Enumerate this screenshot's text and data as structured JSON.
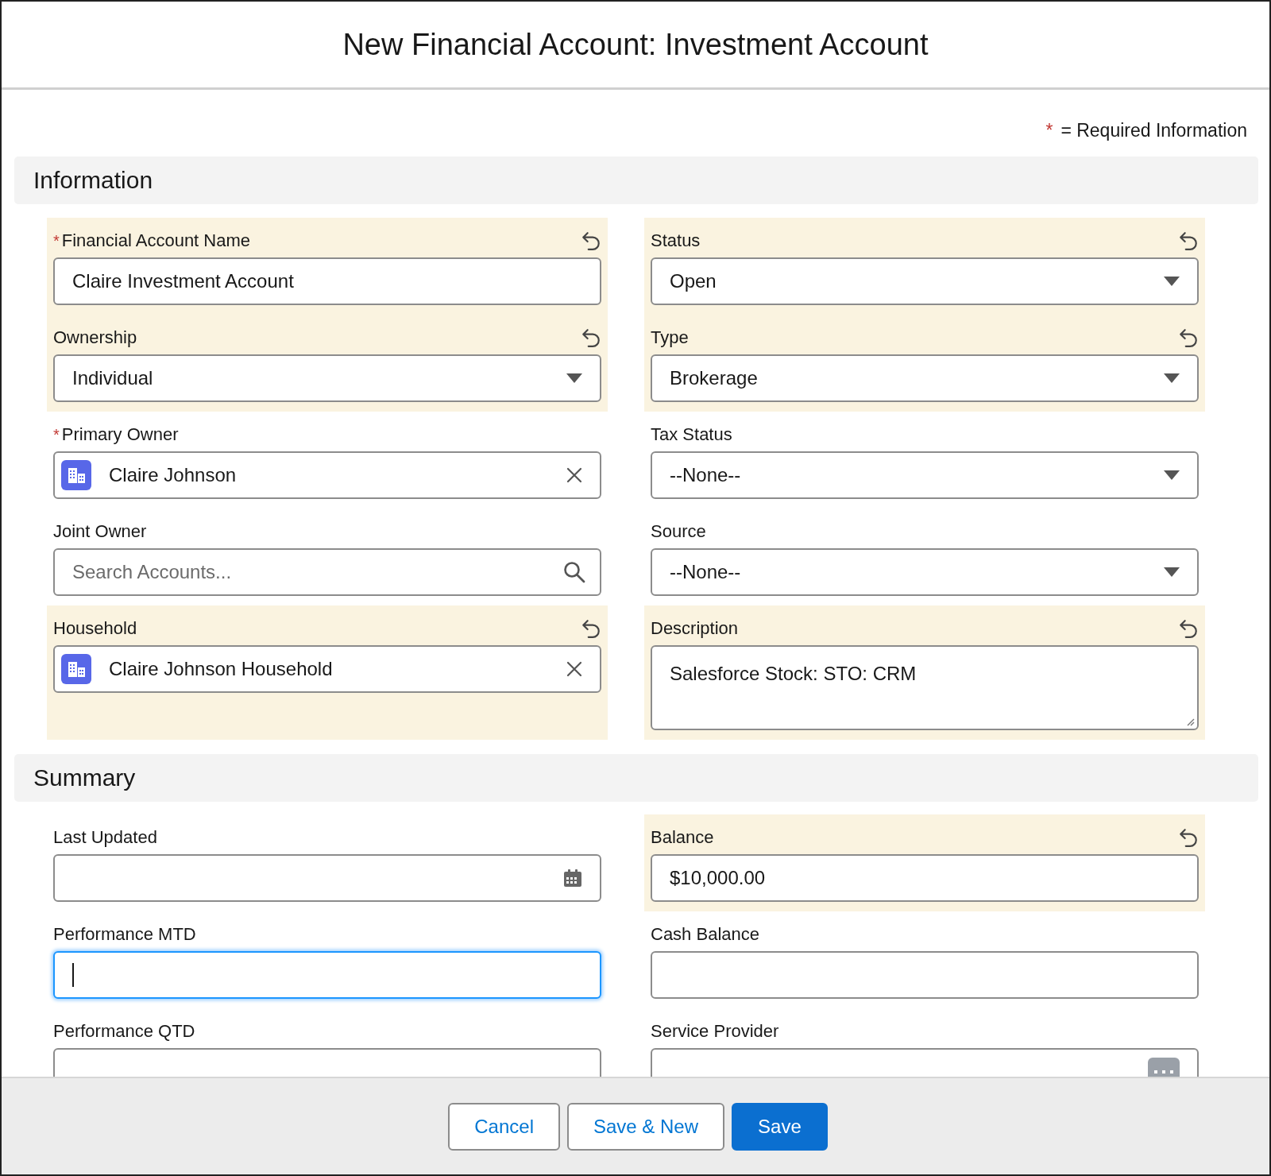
{
  "modal": {
    "title": "New Financial Account: Investment Account"
  },
  "required_legend": {
    "mark": "*",
    "text": "= Required Information"
  },
  "sections": [
    {
      "title": "Information",
      "fields": [
        {
          "label": "Financial Account Name",
          "required": true,
          "changed": true,
          "kind": "text",
          "value": "Claire Investment Account"
        },
        {
          "label": "Status",
          "required": false,
          "changed": true,
          "kind": "picklist",
          "value": "Open"
        },
        {
          "label": "Ownership",
          "required": false,
          "changed": true,
          "kind": "picklist",
          "value": "Individual"
        },
        {
          "label": "Type",
          "required": false,
          "changed": true,
          "kind": "picklist",
          "value": "Brokerage"
        },
        {
          "label": "Primary Owner",
          "required": true,
          "changed": false,
          "kind": "lookup",
          "value": "Claire Johnson"
        },
        {
          "label": "Tax Status",
          "required": false,
          "changed": false,
          "kind": "picklist",
          "value": "--None--"
        },
        {
          "label": "Joint Owner",
          "required": false,
          "changed": false,
          "kind": "search",
          "placeholder": "Search Accounts..."
        },
        {
          "label": "Source",
          "required": false,
          "changed": false,
          "kind": "picklist",
          "value": "--None--"
        },
        {
          "label": "Household",
          "required": false,
          "changed": true,
          "kind": "lookup",
          "value": "Claire Johnson Household"
        },
        {
          "label": "Description",
          "required": false,
          "changed": true,
          "kind": "textarea",
          "value": "Salesforce Stock: STO: CRM"
        }
      ]
    },
    {
      "title": "Summary",
      "fields": [
        {
          "label": "Last Updated",
          "required": false,
          "changed": false,
          "kind": "date"
        },
        {
          "label": "Balance",
          "required": false,
          "changed": true,
          "kind": "text",
          "value": "$10,000.00"
        },
        {
          "label": "Performance MTD",
          "required": false,
          "changed": false,
          "kind": "text",
          "focused": true
        },
        {
          "label": "Cash Balance",
          "required": false,
          "changed": false,
          "kind": "text",
          "focused": false
        },
        {
          "label": "Performance QTD",
          "required": false,
          "changed": false,
          "kind": "text",
          "focused": false
        },
        {
          "label": "Service Provider",
          "required": false,
          "changed": false,
          "kind": "picker"
        }
      ]
    }
  ],
  "buttons": [
    {
      "label": "Cancel",
      "kind": "neutral"
    },
    {
      "label": "Save & New",
      "kind": "neutral"
    },
    {
      "label": "Save",
      "kind": "brand"
    }
  ]
}
